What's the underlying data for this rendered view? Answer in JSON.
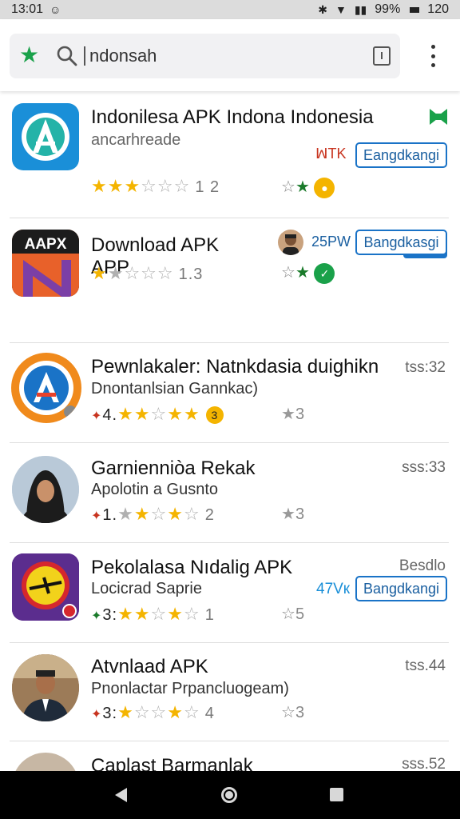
{
  "status_bar": {
    "time": "13:01",
    "battery": "99%",
    "right_number": "120"
  },
  "search": {
    "query": "ndonsah"
  },
  "apps": [
    {
      "title": "Indonilesa APK Indona Indonesia",
      "subtitle": "ancarhreade",
      "rating_label": "1 2",
      "badge_text": "ꟽTK",
      "install_label": "Eangdkangi",
      "colors": {
        "icon": "#1a8fd8",
        "badge": "#1aa14a"
      }
    },
    {
      "title_line1": "Download APK",
      "title_line2": "APP",
      "icon_text": "AAPX",
      "rating_label": "1.3",
      "tag": "#C1",
      "size": "25PW",
      "install_label": "Bangdkasgi"
    },
    {
      "title": "Pewnlakaler: Natnkdasia duighikn",
      "subtitle": "Dnontanlsian Gannkac)",
      "time": "tss:32",
      "rating_value": "4.",
      "badge_num": "3",
      "right_count": "3"
    },
    {
      "title": "Garnienniòa Rekak",
      "subtitle": "Apolotin a Gusnto",
      "time": "sss:33",
      "rating_value": "1.",
      "rating_tail": "2",
      "right_count": "3"
    },
    {
      "title": "Pekolalasa Nıdalig APK",
      "subtitle": "Locicrad Saprie",
      "time": "Besdlo",
      "rating_value": "3:",
      "rating_tail": "1",
      "size": "47Vк",
      "install_label": "Bangdkangi",
      "right_count": "5"
    },
    {
      "title": "Atvnlaad APK",
      "subtitle": "Pnonlactar Prpancluogeam)",
      "time": "tss.44",
      "rating_value": "3:",
      "rating_tail": "4",
      "right_count": "3"
    },
    {
      "title": "Caplast Barmanlak",
      "time": "sss.52"
    }
  ]
}
